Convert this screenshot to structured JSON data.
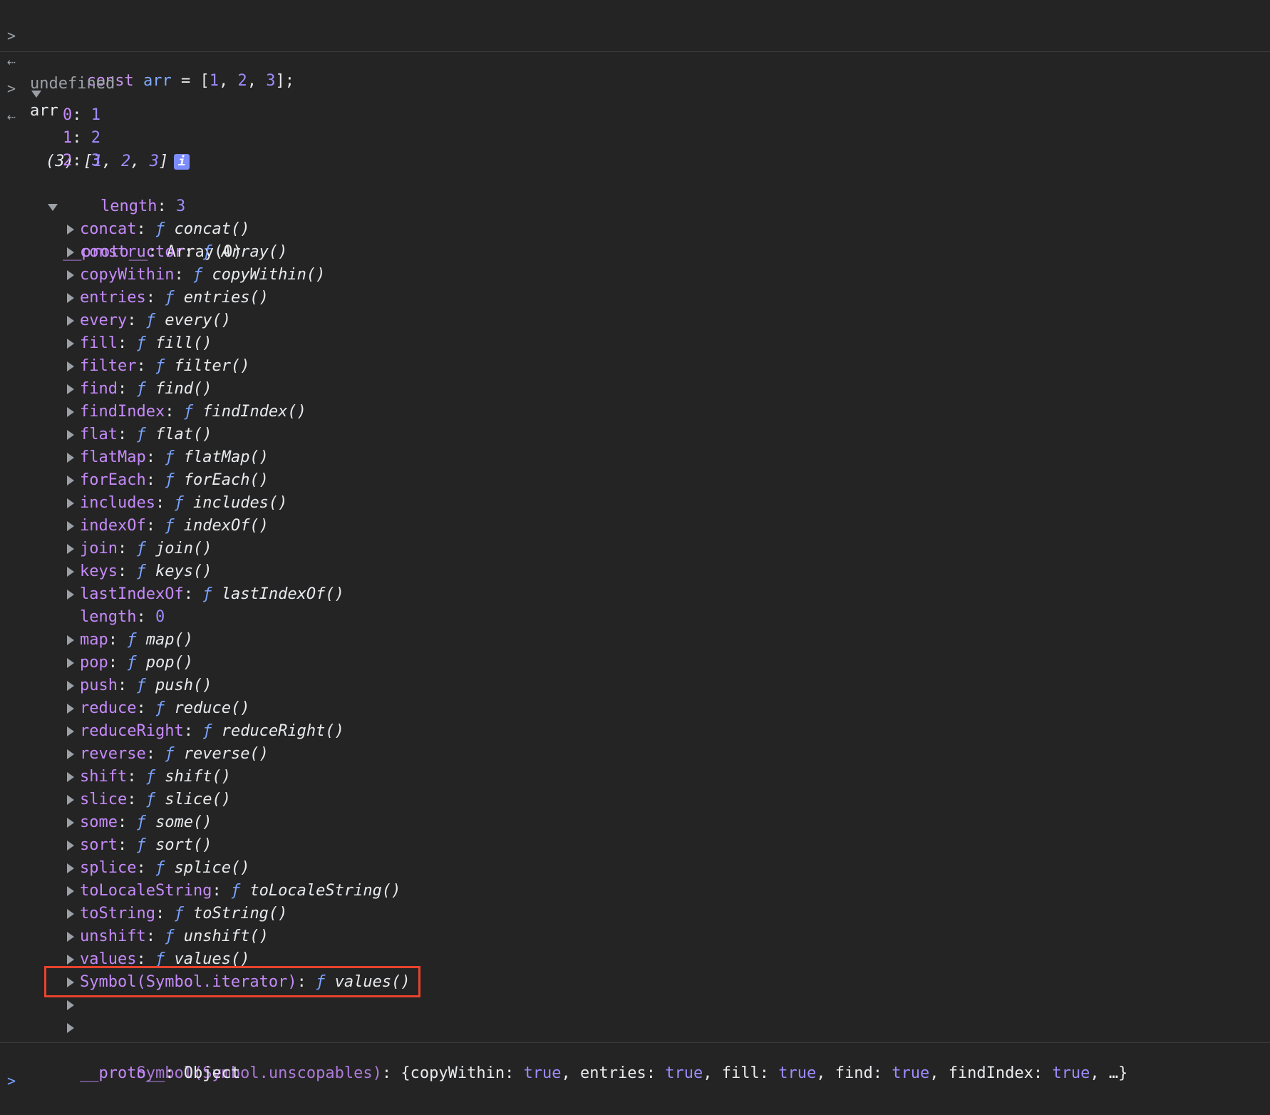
{
  "entry1": {
    "input_kw": "const",
    "input_var": "arr",
    "input_eq": "=",
    "input_arr_open": "[",
    "input_1": "1",
    "input_2": "2",
    "input_3": "3",
    "input_close": "];",
    "result": "undefined"
  },
  "entry2": {
    "input": "arr",
    "summary_prefix": "(3) [",
    "summary_v1": "1",
    "summary_v2": "2",
    "summary_v3": "3",
    "summary_suffix": "]",
    "info_glyph": "i"
  },
  "indices": [
    {
      "key": "0",
      "value": "1"
    },
    {
      "key": "1",
      "value": "2"
    },
    {
      "key": "2",
      "value": "3"
    }
  ],
  "length_row": {
    "key": "length",
    "value": "3"
  },
  "proto_row": {
    "key": "__proto__",
    "value": "Array(0)"
  },
  "f_symbol": "ƒ",
  "methods": [
    {
      "key": "concat",
      "fn": "concat()"
    },
    {
      "key": "constructor",
      "fn": "Array()"
    },
    {
      "key": "copyWithin",
      "fn": "copyWithin()"
    },
    {
      "key": "entries",
      "fn": "entries()"
    },
    {
      "key": "every",
      "fn": "every()"
    },
    {
      "key": "fill",
      "fn": "fill()"
    },
    {
      "key": "filter",
      "fn": "filter()"
    },
    {
      "key": "find",
      "fn": "find()"
    },
    {
      "key": "findIndex",
      "fn": "findIndex()"
    },
    {
      "key": "flat",
      "fn": "flat()"
    },
    {
      "key": "flatMap",
      "fn": "flatMap()"
    },
    {
      "key": "forEach",
      "fn": "forEach()"
    },
    {
      "key": "includes",
      "fn": "includes()"
    },
    {
      "key": "indexOf",
      "fn": "indexOf()"
    },
    {
      "key": "join",
      "fn": "join()"
    },
    {
      "key": "keys",
      "fn": "keys()"
    },
    {
      "key": "lastIndexOf",
      "fn": "lastIndexOf()"
    },
    {
      "key": "length",
      "value": "0"
    },
    {
      "key": "map",
      "fn": "map()"
    },
    {
      "key": "pop",
      "fn": "pop()"
    },
    {
      "key": "push",
      "fn": "push()"
    },
    {
      "key": "reduce",
      "fn": "reduce()"
    },
    {
      "key": "reduceRight",
      "fn": "reduceRight()"
    },
    {
      "key": "reverse",
      "fn": "reverse()"
    },
    {
      "key": "shift",
      "fn": "shift()"
    },
    {
      "key": "slice",
      "fn": "slice()"
    },
    {
      "key": "some",
      "fn": "some()"
    },
    {
      "key": "sort",
      "fn": "sort()"
    },
    {
      "key": "splice",
      "fn": "splice()"
    },
    {
      "key": "toLocaleString",
      "fn": "toLocaleString()"
    },
    {
      "key": "toString",
      "fn": "toString()"
    },
    {
      "key": "unshift",
      "fn": "unshift()"
    },
    {
      "key": "values",
      "fn": "values()"
    },
    {
      "key": "Symbol(Symbol.iterator)",
      "fn": "values()"
    }
  ],
  "unscopables": {
    "key": "Symbol(Symbol.unscopables)",
    "open": "{",
    "pairs": [
      {
        "k": "copyWithin",
        "v": "true"
      },
      {
        "k": "entries",
        "v": "true"
      },
      {
        "k": "fill",
        "v": "true"
      },
      {
        "k": "find",
        "v": "true"
      },
      {
        "k": "findIndex",
        "v": "true"
      }
    ],
    "tail": "…}"
  },
  "proto_object": {
    "key": "__proto__",
    "value": "Object"
  },
  "colors": {
    "background": "#242424",
    "key": "#c58af9",
    "number": "#9e8cff",
    "function_symbol": "#7aa2ff",
    "highlight_border": "#e8432d"
  }
}
